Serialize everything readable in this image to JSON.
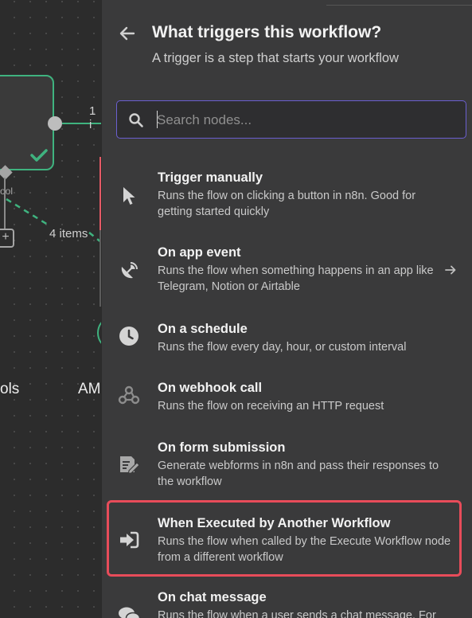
{
  "canvas": {
    "items_count_1": "1 i",
    "tool_label": "ool",
    "items_count_4": "4 items",
    "plus_symbol": "+",
    "bottom_label_left": "ols",
    "bottom_label_right": "AM"
  },
  "panel": {
    "title": "What triggers this workflow?",
    "subtitle": "A trigger is a step that starts your workflow",
    "search_placeholder": "Search nodes...",
    "search_value": ""
  },
  "triggers": [
    {
      "name": "Trigger manually",
      "description": "Runs the flow on clicking a button in n8n. Good for getting started quickly",
      "icon": "cursor-icon"
    },
    {
      "name": "On app event",
      "description": "Runs the flow when something happens in an app like Telegram, Notion or Airtable",
      "icon": "satellite-dish-icon",
      "has_arrow": true
    },
    {
      "name": "On a schedule",
      "description": "Runs the flow every day, hour, or custom interval",
      "icon": "clock-icon"
    },
    {
      "name": "On webhook call",
      "description": "Runs the flow on receiving an HTTP request",
      "icon": "webhook-icon"
    },
    {
      "name": "On form submission",
      "description": "Generate webforms in n8n and pass their responses to the workflow",
      "icon": "form-icon"
    },
    {
      "name": "When Executed by Another Workflow",
      "description": "Runs the flow when called by the Execute Workflow node from a different workflow",
      "icon": "sign-in-arrow-icon",
      "highlighted": true
    },
    {
      "name": "On chat message",
      "description": "Runs the flow when a user sends a chat message. For",
      "icon": "chat-bubbles-icon"
    }
  ],
  "colors": {
    "panel_bg": "#3a3a3b",
    "canvas_bg": "#2c2c2c",
    "accent_purple": "#6b5fd0",
    "highlight_red": "#e84c5a",
    "node_green": "#3fb37f"
  }
}
